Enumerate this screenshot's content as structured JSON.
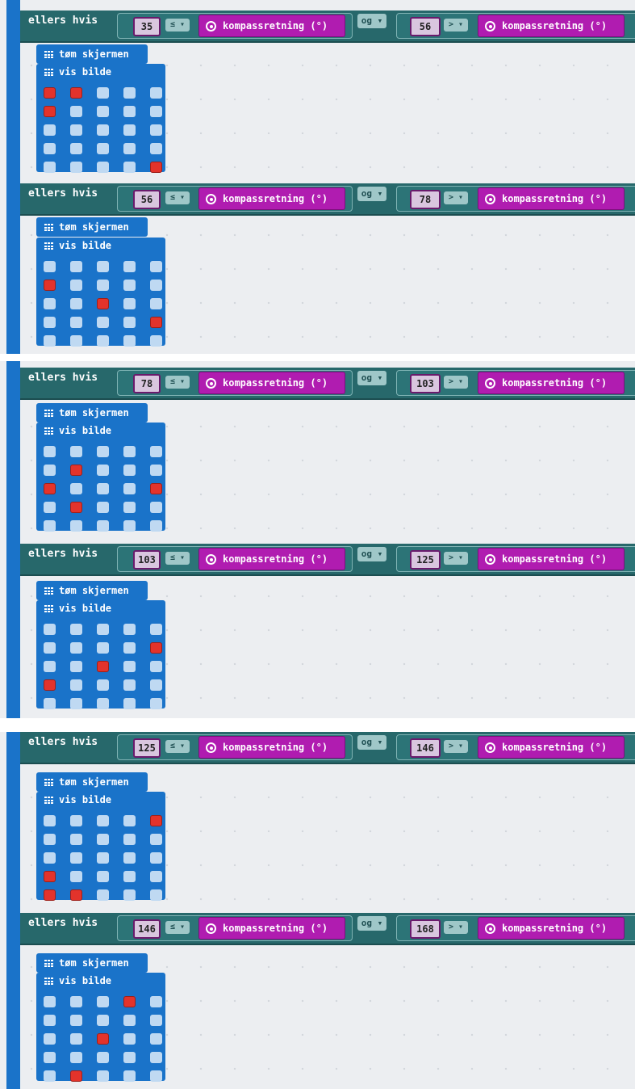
{
  "labels": {
    "else_if": "ellers hvis",
    "and": "og",
    "compass": "kompassretning (°)",
    "clear": "tøm skjermen",
    "show": "vis bilde",
    "op_le": "≤ ▾",
    "op_gt": "> ▾",
    "og_dd": "og ▾"
  },
  "blocks": [
    {
      "low": "35",
      "high": "56",
      "leds": [
        [
          1,
          1,
          0,
          0,
          0
        ],
        [
          1,
          0,
          0,
          0,
          0
        ],
        [
          0,
          0,
          0,
          0,
          0
        ],
        [
          0,
          0,
          0,
          0,
          0
        ],
        [
          0,
          0,
          0,
          0,
          1
        ]
      ]
    },
    {
      "low": "56",
      "high": "78",
      "leds": [
        [
          0,
          0,
          0,
          0,
          0
        ],
        [
          1,
          0,
          0,
          0,
          0
        ],
        [
          0,
          0,
          1,
          0,
          0
        ],
        [
          0,
          0,
          0,
          0,
          1
        ],
        [
          0,
          0,
          0,
          0,
          0
        ]
      ]
    },
    {
      "low": "78",
      "high": "103",
      "leds": [
        [
          0,
          0,
          0,
          0,
          0
        ],
        [
          0,
          1,
          0,
          0,
          0
        ],
        [
          1,
          0,
          0,
          0,
          1
        ],
        [
          0,
          1,
          0,
          0,
          0
        ],
        [
          0,
          0,
          0,
          0,
          0
        ]
      ]
    },
    {
      "low": "103",
      "high": "125",
      "leds": [
        [
          0,
          0,
          0,
          0,
          0
        ],
        [
          0,
          0,
          0,
          0,
          1
        ],
        [
          0,
          0,
          1,
          0,
          0
        ],
        [
          1,
          0,
          0,
          0,
          0
        ],
        [
          0,
          0,
          0,
          0,
          0
        ]
      ]
    },
    {
      "low": "125",
      "high": "146",
      "leds": [
        [
          0,
          0,
          0,
          0,
          1
        ],
        [
          0,
          0,
          0,
          0,
          0
        ],
        [
          0,
          0,
          0,
          0,
          0
        ],
        [
          1,
          0,
          0,
          0,
          0
        ],
        [
          1,
          1,
          0,
          0,
          0
        ]
      ]
    },
    {
      "low": "146",
      "high": "168",
      "leds": [
        [
          0,
          0,
          0,
          1,
          0
        ],
        [
          0,
          0,
          0,
          0,
          0
        ],
        [
          0,
          0,
          1,
          0,
          0
        ],
        [
          0,
          0,
          0,
          0,
          0
        ],
        [
          0,
          1,
          0,
          0,
          0
        ]
      ]
    }
  ]
}
